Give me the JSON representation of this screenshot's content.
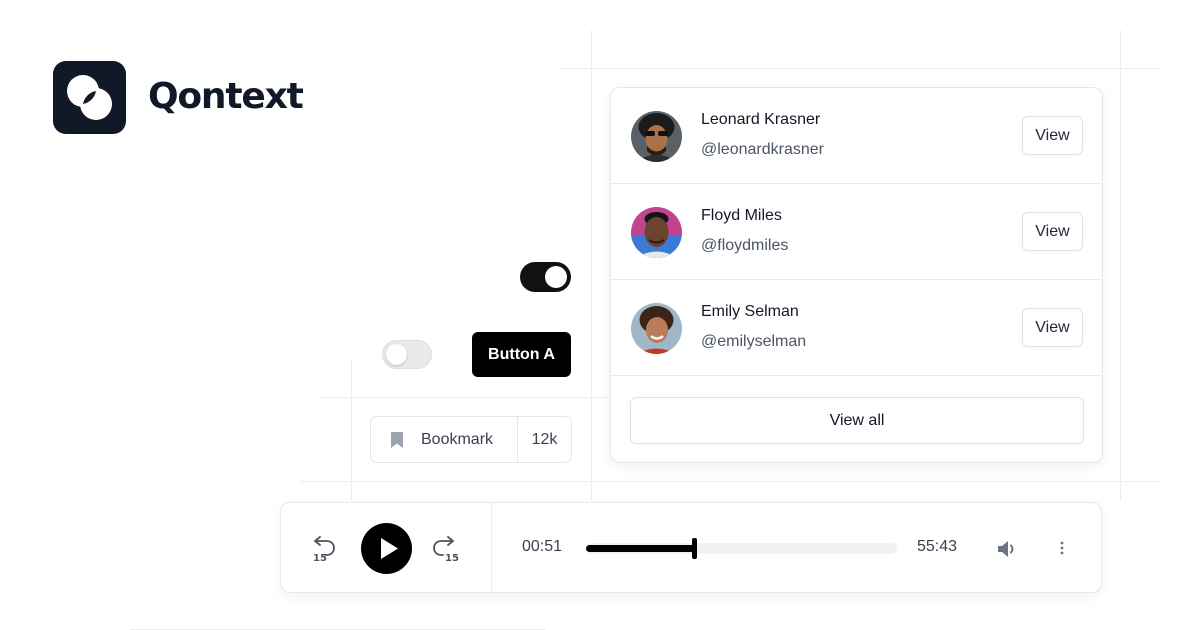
{
  "brand": {
    "name": "Qontext",
    "trademark": "™"
  },
  "controls": {
    "toggle_on_state": true,
    "toggle_off_state": false,
    "button_a_label": "Button A",
    "bookmark_label": "Bookmark",
    "bookmark_count": "12k"
  },
  "users": [
    {
      "name": "Leonard Krasner",
      "handle": "@leonardkrasner",
      "action": "View"
    },
    {
      "name": "Floyd Miles",
      "handle": "@floydmiles",
      "action": "View"
    },
    {
      "name": "Emily Selman",
      "handle": "@emilyselman",
      "action": "View"
    }
  ],
  "view_all_label": "View all",
  "player": {
    "current_time": "00:51",
    "duration": "55:43",
    "progress": 0.35,
    "skip_back": "15",
    "skip_forward": "15"
  },
  "colors": {
    "primary": "#000000",
    "text": "#111827",
    "muted": "#4b5563",
    "border": "#e5e7eb"
  }
}
